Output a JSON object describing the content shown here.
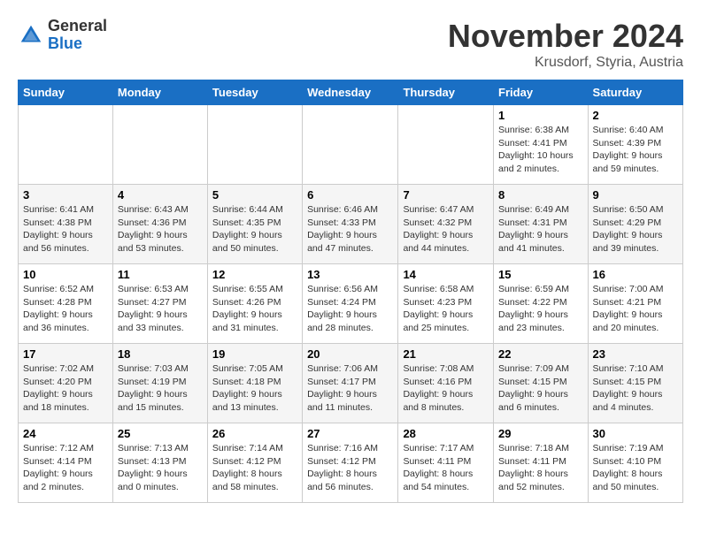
{
  "header": {
    "logo_general": "General",
    "logo_blue": "Blue",
    "title": "November 2024",
    "subtitle": "Krusdorf, Styria, Austria"
  },
  "days_of_week": [
    "Sunday",
    "Monday",
    "Tuesday",
    "Wednesday",
    "Thursday",
    "Friday",
    "Saturday"
  ],
  "weeks": [
    [
      {
        "day": "",
        "info": ""
      },
      {
        "day": "",
        "info": ""
      },
      {
        "day": "",
        "info": ""
      },
      {
        "day": "",
        "info": ""
      },
      {
        "day": "",
        "info": ""
      },
      {
        "day": "1",
        "info": "Sunrise: 6:38 AM\nSunset: 4:41 PM\nDaylight: 10 hours and 2 minutes."
      },
      {
        "day": "2",
        "info": "Sunrise: 6:40 AM\nSunset: 4:39 PM\nDaylight: 9 hours and 59 minutes."
      }
    ],
    [
      {
        "day": "3",
        "info": "Sunrise: 6:41 AM\nSunset: 4:38 PM\nDaylight: 9 hours and 56 minutes."
      },
      {
        "day": "4",
        "info": "Sunrise: 6:43 AM\nSunset: 4:36 PM\nDaylight: 9 hours and 53 minutes."
      },
      {
        "day": "5",
        "info": "Sunrise: 6:44 AM\nSunset: 4:35 PM\nDaylight: 9 hours and 50 minutes."
      },
      {
        "day": "6",
        "info": "Sunrise: 6:46 AM\nSunset: 4:33 PM\nDaylight: 9 hours and 47 minutes."
      },
      {
        "day": "7",
        "info": "Sunrise: 6:47 AM\nSunset: 4:32 PM\nDaylight: 9 hours and 44 minutes."
      },
      {
        "day": "8",
        "info": "Sunrise: 6:49 AM\nSunset: 4:31 PM\nDaylight: 9 hours and 41 minutes."
      },
      {
        "day": "9",
        "info": "Sunrise: 6:50 AM\nSunset: 4:29 PM\nDaylight: 9 hours and 39 minutes."
      }
    ],
    [
      {
        "day": "10",
        "info": "Sunrise: 6:52 AM\nSunset: 4:28 PM\nDaylight: 9 hours and 36 minutes."
      },
      {
        "day": "11",
        "info": "Sunrise: 6:53 AM\nSunset: 4:27 PM\nDaylight: 9 hours and 33 minutes."
      },
      {
        "day": "12",
        "info": "Sunrise: 6:55 AM\nSunset: 4:26 PM\nDaylight: 9 hours and 31 minutes."
      },
      {
        "day": "13",
        "info": "Sunrise: 6:56 AM\nSunset: 4:24 PM\nDaylight: 9 hours and 28 minutes."
      },
      {
        "day": "14",
        "info": "Sunrise: 6:58 AM\nSunset: 4:23 PM\nDaylight: 9 hours and 25 minutes."
      },
      {
        "day": "15",
        "info": "Sunrise: 6:59 AM\nSunset: 4:22 PM\nDaylight: 9 hours and 23 minutes."
      },
      {
        "day": "16",
        "info": "Sunrise: 7:00 AM\nSunset: 4:21 PM\nDaylight: 9 hours and 20 minutes."
      }
    ],
    [
      {
        "day": "17",
        "info": "Sunrise: 7:02 AM\nSunset: 4:20 PM\nDaylight: 9 hours and 18 minutes."
      },
      {
        "day": "18",
        "info": "Sunrise: 7:03 AM\nSunset: 4:19 PM\nDaylight: 9 hours and 15 minutes."
      },
      {
        "day": "19",
        "info": "Sunrise: 7:05 AM\nSunset: 4:18 PM\nDaylight: 9 hours and 13 minutes."
      },
      {
        "day": "20",
        "info": "Sunrise: 7:06 AM\nSunset: 4:17 PM\nDaylight: 9 hours and 11 minutes."
      },
      {
        "day": "21",
        "info": "Sunrise: 7:08 AM\nSunset: 4:16 PM\nDaylight: 9 hours and 8 minutes."
      },
      {
        "day": "22",
        "info": "Sunrise: 7:09 AM\nSunset: 4:15 PM\nDaylight: 9 hours and 6 minutes."
      },
      {
        "day": "23",
        "info": "Sunrise: 7:10 AM\nSunset: 4:15 PM\nDaylight: 9 hours and 4 minutes."
      }
    ],
    [
      {
        "day": "24",
        "info": "Sunrise: 7:12 AM\nSunset: 4:14 PM\nDaylight: 9 hours and 2 minutes."
      },
      {
        "day": "25",
        "info": "Sunrise: 7:13 AM\nSunset: 4:13 PM\nDaylight: 9 hours and 0 minutes."
      },
      {
        "day": "26",
        "info": "Sunrise: 7:14 AM\nSunset: 4:12 PM\nDaylight: 8 hours and 58 minutes."
      },
      {
        "day": "27",
        "info": "Sunrise: 7:16 AM\nSunset: 4:12 PM\nDaylight: 8 hours and 56 minutes."
      },
      {
        "day": "28",
        "info": "Sunrise: 7:17 AM\nSunset: 4:11 PM\nDaylight: 8 hours and 54 minutes."
      },
      {
        "day": "29",
        "info": "Sunrise: 7:18 AM\nSunset: 4:11 PM\nDaylight: 8 hours and 52 minutes."
      },
      {
        "day": "30",
        "info": "Sunrise: 7:19 AM\nSunset: 4:10 PM\nDaylight: 8 hours and 50 minutes."
      }
    ]
  ]
}
